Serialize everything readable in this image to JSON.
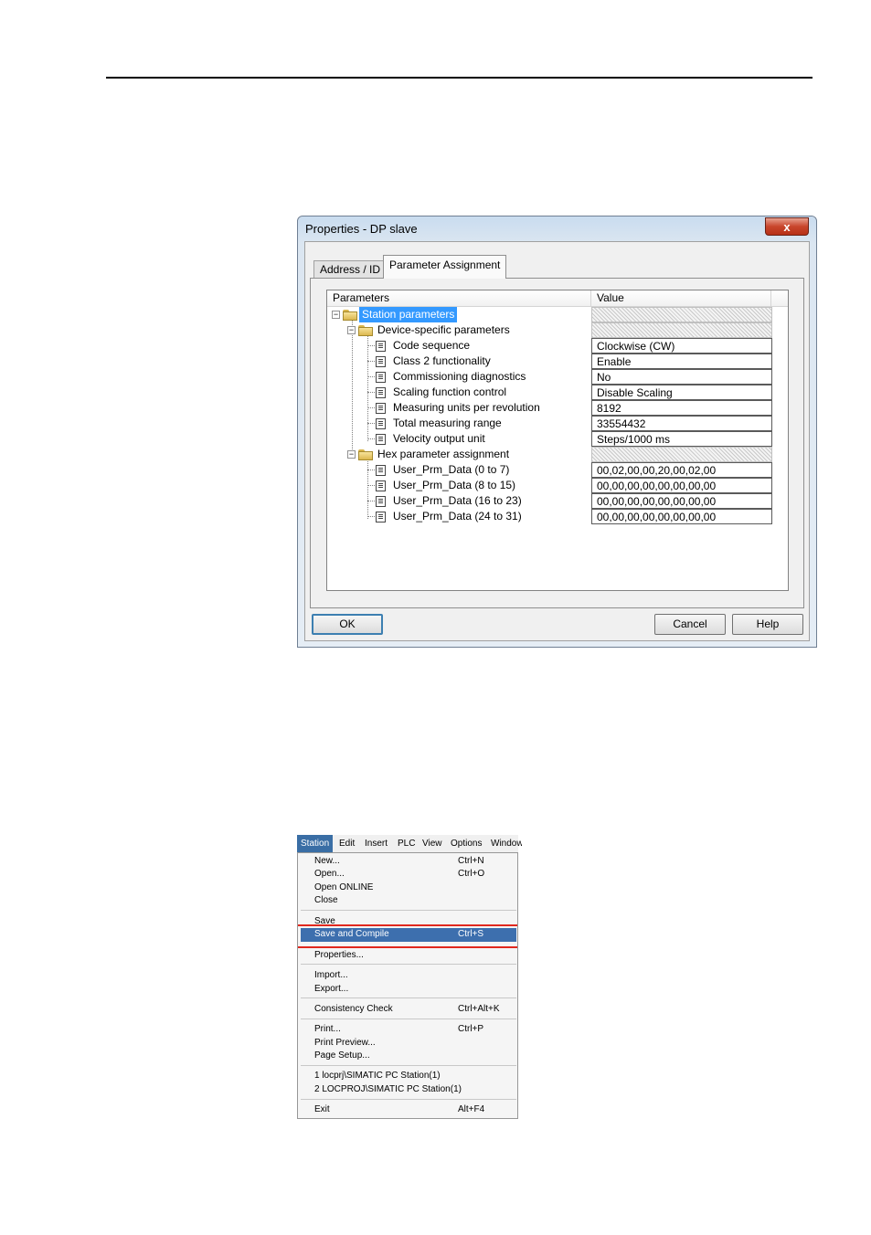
{
  "dialog": {
    "title": "Properties - DP slave",
    "close_glyph": "x",
    "tabs": {
      "address": "Address / ID",
      "parameter": "Parameter Assignment"
    },
    "grid": {
      "header": {
        "parameters": "Parameters",
        "value": "Value"
      },
      "rows": [
        {
          "name": "Station parameters",
          "value": ""
        },
        {
          "name": "Device-specific parameters",
          "value": ""
        },
        {
          "name": "Code sequence",
          "value": "Clockwise (CW)"
        },
        {
          "name": "Class 2 functionality",
          "value": "Enable"
        },
        {
          "name": "Commissioning diagnostics",
          "value": "No"
        },
        {
          "name": "Scaling function control",
          "value": "Disable Scaling"
        },
        {
          "name": "Measuring units per revolution",
          "value": "8192"
        },
        {
          "name": "Total measuring range",
          "value": "33554432"
        },
        {
          "name": "Velocity output unit",
          "value": "Steps/1000 ms"
        },
        {
          "name": "Hex parameter assignment",
          "value": ""
        },
        {
          "name": "User_Prm_Data (0 to 7)",
          "value": "00,02,00,00,20,00,02,00"
        },
        {
          "name": "User_Prm_Data (8 to 15)",
          "value": "00,00,00,00,00,00,00,00"
        },
        {
          "name": "User_Prm_Data (16 to 23)",
          "value": "00,00,00,00,00,00,00,00"
        },
        {
          "name": "User_Prm_Data (24 to 31)",
          "value": "00,00,00,00,00,00,00,00"
        }
      ]
    },
    "buttons": {
      "ok": "OK",
      "cancel": "Cancel",
      "help": "Help"
    }
  },
  "menu": {
    "bar": [
      "Station",
      "Edit",
      "Insert",
      "PLC",
      "View",
      "Options",
      "Window"
    ],
    "items": [
      {
        "label": "New...",
        "shortcut": "Ctrl+N"
      },
      {
        "label": "Open...",
        "shortcut": "Ctrl+O"
      },
      {
        "label": "Open ONLINE",
        "shortcut": ""
      },
      {
        "label": "Close",
        "shortcut": ""
      },
      {
        "label": "Save",
        "shortcut": ""
      },
      {
        "label": "Save and Compile",
        "shortcut": "Ctrl+S"
      },
      {
        "label": "Properties...",
        "shortcut": ""
      },
      {
        "label": "Import...",
        "shortcut": ""
      },
      {
        "label": "Export...",
        "shortcut": ""
      },
      {
        "label": "Consistency Check",
        "shortcut": "Ctrl+Alt+K"
      },
      {
        "label": "Print...",
        "shortcut": "Ctrl+P"
      },
      {
        "label": "Print Preview...",
        "shortcut": ""
      },
      {
        "label": "Page Setup...",
        "shortcut": ""
      },
      {
        "label": "1 locprj\\SIMATIC PC Station(1)",
        "shortcut": ""
      },
      {
        "label": "2 LOCPROJ\\SIMATIC PC Station(1)",
        "shortcut": ""
      },
      {
        "label": "Exit",
        "shortcut": "Alt+F4"
      }
    ]
  },
  "colors": {
    "selection": "#3399ff",
    "menu_highlight": "#3d6fae",
    "annotation_red": "#e0281e",
    "close_button": "#c8452b"
  }
}
